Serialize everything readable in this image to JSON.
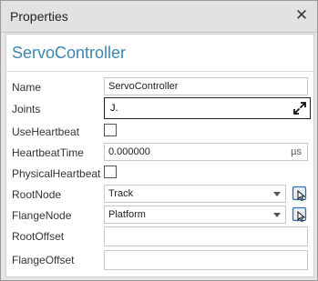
{
  "window": {
    "title": "Properties"
  },
  "header": {
    "heading": "ServoController"
  },
  "rows": {
    "name": {
      "label": "Name",
      "value": "ServoController"
    },
    "joints": {
      "label": "Joints",
      "value": "J."
    },
    "use_heartbeat": {
      "label": "UseHeartbeat",
      "checked": false
    },
    "heartbeat_time": {
      "label": "HeartbeatTime",
      "value": "0.000000",
      "unit": "µs"
    },
    "physical_heartbeat": {
      "label": "PhysicalHeartbeat",
      "checked": false
    },
    "root_node": {
      "label": "RootNode",
      "value": "Track"
    },
    "flange_node": {
      "label": "FlangeNode",
      "value": "Platform"
    },
    "root_offset": {
      "label": "RootOffset",
      "value": ""
    },
    "flange_offset": {
      "label": "FlangeOffset",
      "value": ""
    }
  },
  "icons": {
    "close": "close-icon",
    "expand": "expand-icon",
    "dropdown": "chevron-down-icon",
    "node_picker": "node-picker-icon"
  },
  "colors": {
    "heading": "#3a86b0",
    "panel_bg": "#e6e6e6",
    "content_bg": "#ffffff",
    "picker_accent": "#2f6fb2"
  }
}
